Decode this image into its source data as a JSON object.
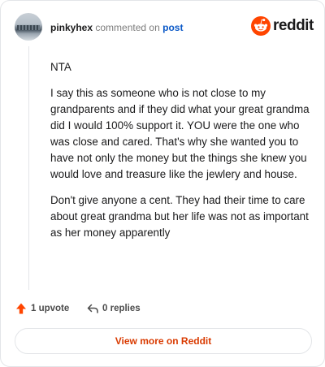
{
  "header": {
    "author": "pinkyhex",
    "action": "commented on",
    "post_link": "post",
    "brand": "reddit"
  },
  "comment": {
    "paragraphs": [
      "NTA",
      "I say this as someone who is not close to my grandparents and if they did what your great grandma did I would 100% support it. YOU were the one who was close and cared. That's why she wanted you to have not only the money but the things she knew you would love and treasure like the jewlery and house.",
      "Don't give anyone a cent. They had their time to care about great grandma but her life was not as important as her money apparently"
    ]
  },
  "footer": {
    "upvote_label": "1 upvote",
    "replies_label": "0 replies"
  },
  "cta": {
    "label": "View more on Reddit"
  },
  "colors": {
    "brand_orange": "#ff4500",
    "link_blue": "#0a58c7",
    "cta_text": "#d93a00"
  }
}
